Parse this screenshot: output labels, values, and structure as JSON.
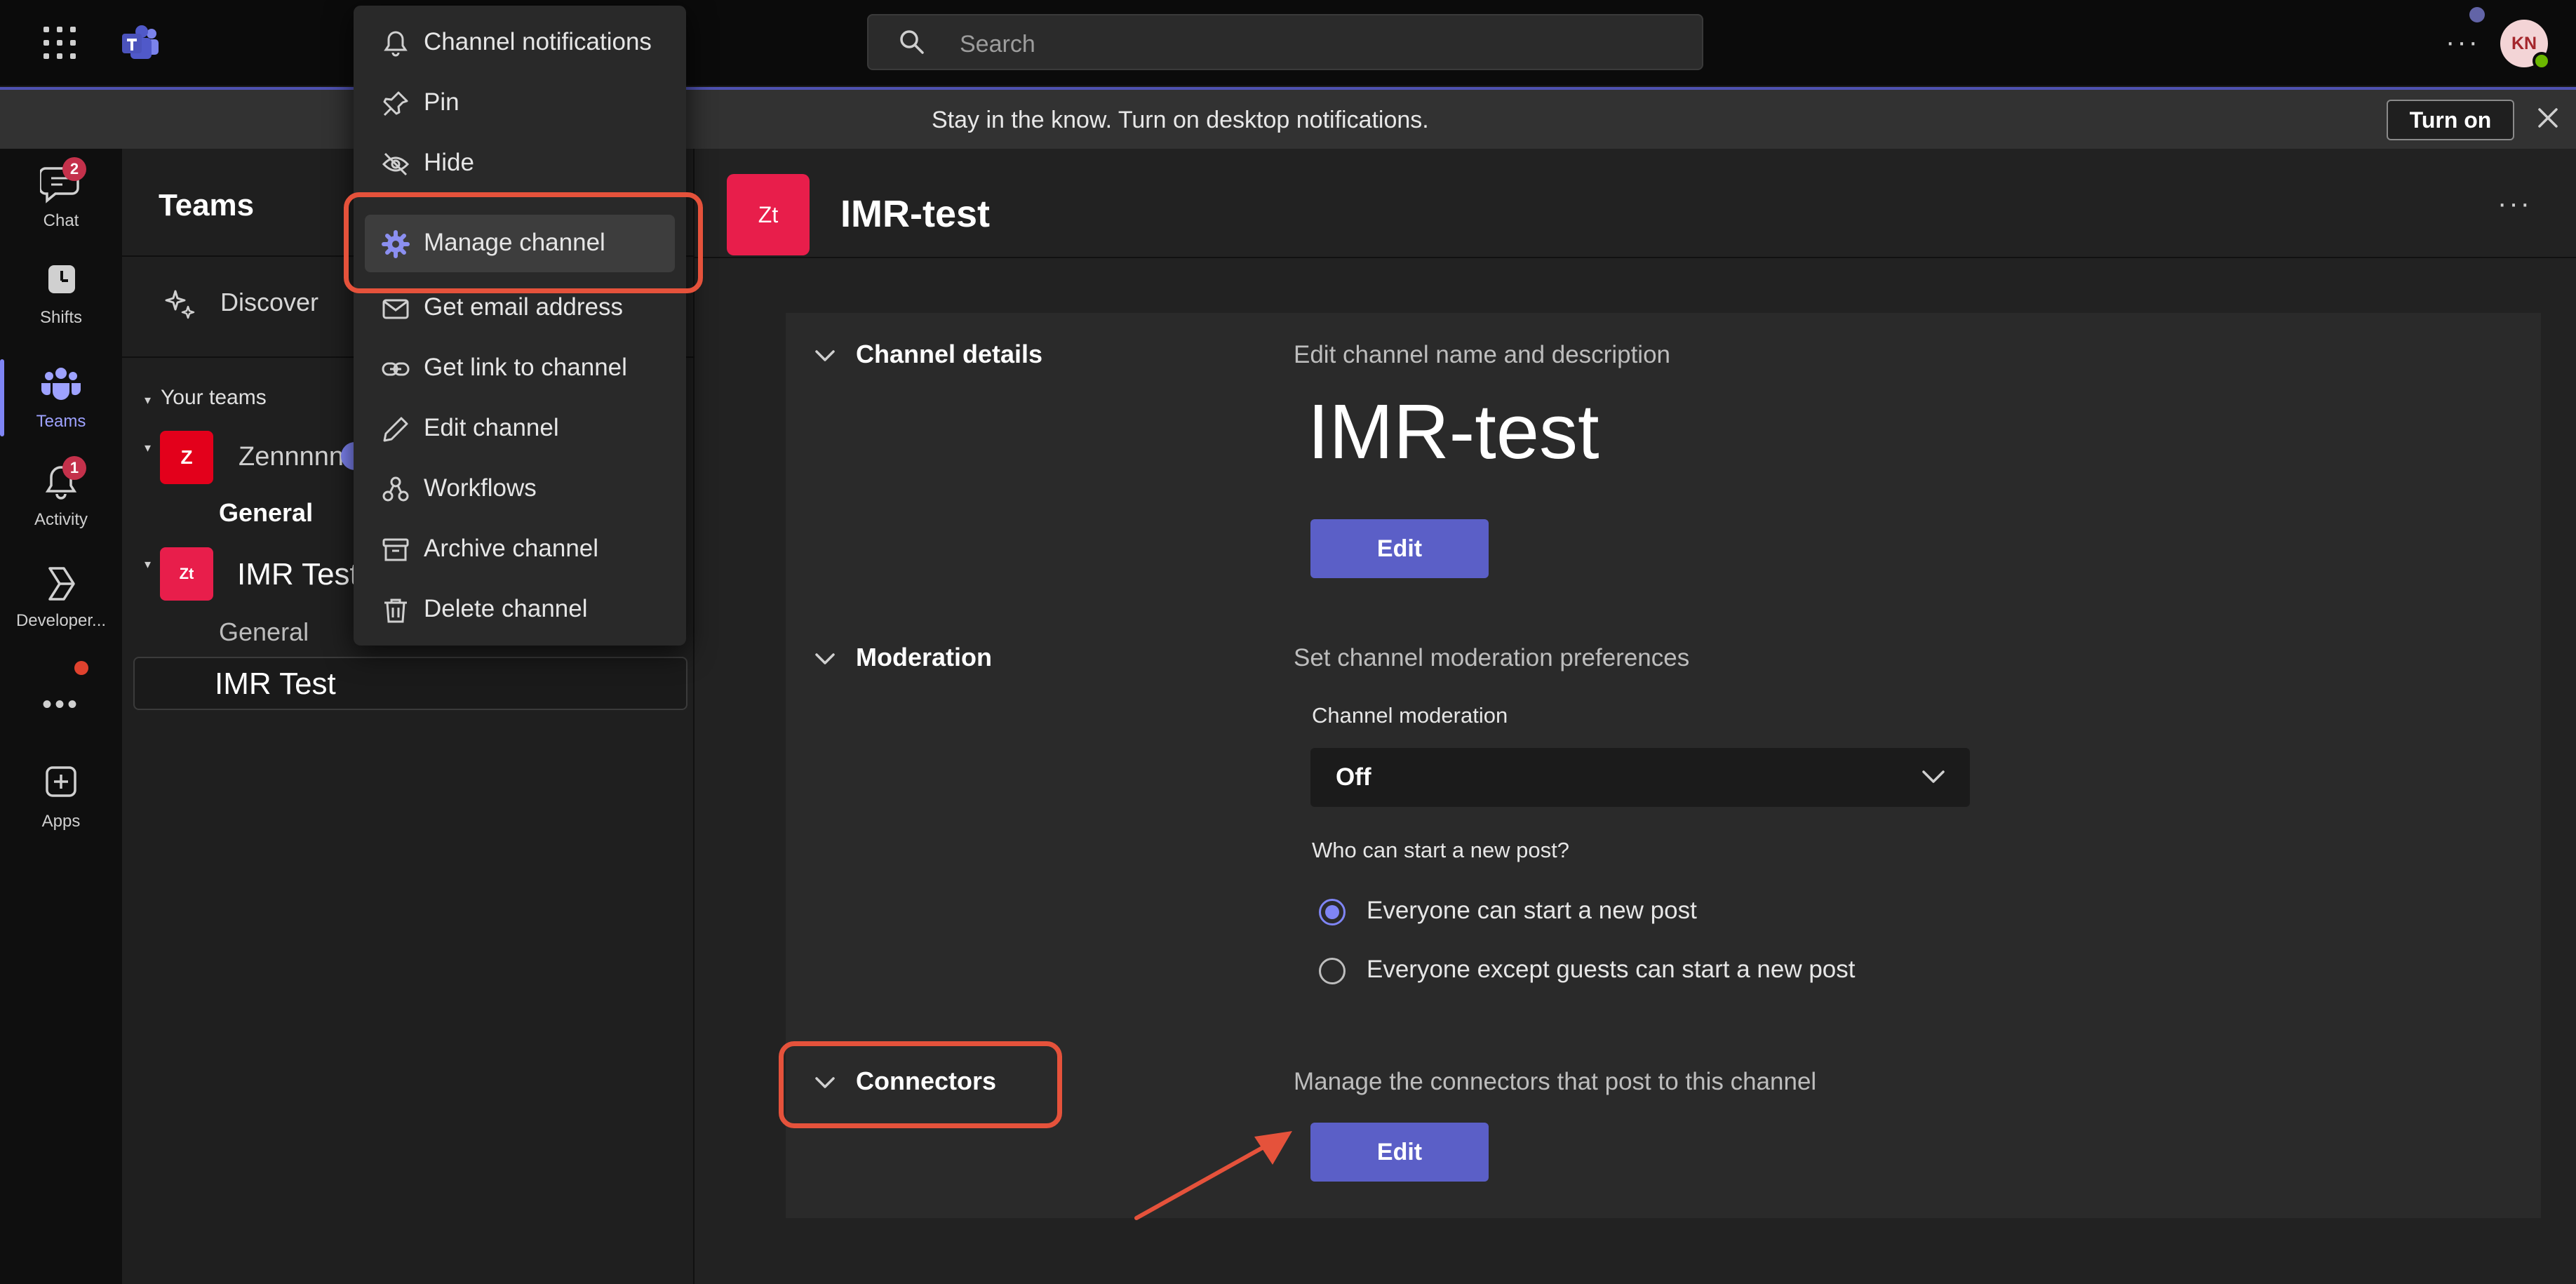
{
  "topbar": {
    "search_placeholder": "Search",
    "more": "···",
    "avatar_initials": "KN"
  },
  "banner": {
    "message": "Stay in the know. Turn on desktop notifications.",
    "turn_on": "Turn on"
  },
  "rail": {
    "items": [
      {
        "label": "Chat",
        "icon": "chat-icon",
        "badge": "2"
      },
      {
        "label": "Shifts",
        "icon": "shifts-icon"
      },
      {
        "label": "Teams",
        "icon": "teams-icon",
        "active": true
      },
      {
        "label": "Activity",
        "icon": "bell-icon",
        "badge": "1"
      },
      {
        "label": "Developer...",
        "icon": "developer-icon"
      },
      {
        "label": "Apps",
        "icon": "plus-square-icon"
      }
    ],
    "more": "•••"
  },
  "teams_pane": {
    "title": "Teams",
    "discover": "Discover",
    "your_teams": "Your teams",
    "teams": [
      {
        "name": "Zennnnn",
        "initials": "Z",
        "color": "#e3001b",
        "channels": [
          "General"
        ]
      },
      {
        "name": "IMR Test",
        "initials": "Zt",
        "color": "#e81e4b",
        "channels": [
          "General",
          "IMR Test"
        ]
      }
    ]
  },
  "context_menu": {
    "items": [
      {
        "label": "Channel notifications",
        "icon": "bell-icon"
      },
      {
        "label": "Pin",
        "icon": "pin-icon"
      },
      {
        "label": "Hide",
        "icon": "eye-off-icon"
      },
      {
        "label": "Manage channel",
        "icon": "gear-icon",
        "highlighted": true
      },
      {
        "label": "Get email address",
        "icon": "mail-icon"
      },
      {
        "label": "Get link to channel",
        "icon": "link-icon"
      },
      {
        "label": "Edit channel",
        "icon": "pencil-icon"
      },
      {
        "label": "Workflows",
        "icon": "workflows-icon"
      },
      {
        "label": "Archive channel",
        "icon": "archive-icon"
      },
      {
        "label": "Delete channel",
        "icon": "trash-icon"
      }
    ]
  },
  "channel": {
    "avatar_initials": "Zt",
    "title": "IMR-test",
    "more": "···"
  },
  "settings": {
    "channel_details": {
      "heading": "Channel details",
      "description": "Edit channel name and description",
      "name": "IMR-test",
      "edit": "Edit"
    },
    "moderation": {
      "heading": "Moderation",
      "description": "Set channel moderation preferences",
      "field_label": "Channel moderation",
      "selected": "Off",
      "question": "Who can start a new post?",
      "options": [
        {
          "label": "Everyone can start a new post",
          "selected": true
        },
        {
          "label": "Everyone except guests can start a new post",
          "selected": false
        }
      ]
    },
    "connectors": {
      "heading": "Connectors",
      "description": "Manage the connectors that post to this channel",
      "edit": "Edit"
    }
  },
  "colors": {
    "accent": "#5b5fc7",
    "annotation": "#e5523b",
    "badge": "#c4314b"
  }
}
